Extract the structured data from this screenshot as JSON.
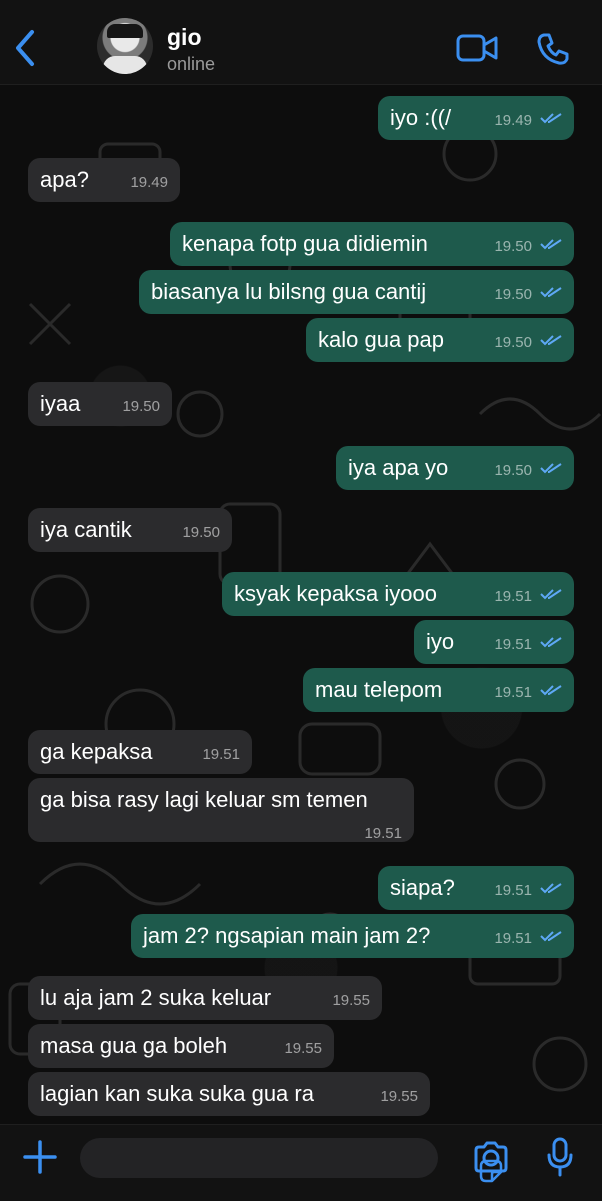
{
  "header": {
    "contact_name": "gio",
    "status": "online"
  },
  "messages": [
    {
      "dir": "out",
      "text": "iyo :((/",
      "time": "19.49",
      "read": true
    },
    {
      "dir": "in",
      "text": "apa?",
      "time": "19.49"
    },
    {
      "dir": "out",
      "text": "kenapa fotp gua didiemin",
      "time": "19.50",
      "read": true
    },
    {
      "dir": "out",
      "text": "biasanya lu bilsng gua cantij",
      "time": "19.50",
      "read": true
    },
    {
      "dir": "out",
      "text": "kalo gua pap",
      "time": "19.50",
      "read": true
    },
    {
      "dir": "in",
      "text": "iyaa",
      "time": "19.50"
    },
    {
      "dir": "out",
      "text": "iya apa yo",
      "time": "19.50",
      "read": true
    },
    {
      "dir": "in",
      "text": "iya cantik",
      "time": "19.50"
    },
    {
      "dir": "out",
      "text": "ksyak kepaksa iyooo",
      "time": "19.51",
      "read": true
    },
    {
      "dir": "out",
      "text": "iyo",
      "time": "19.51",
      "read": true
    },
    {
      "dir": "out",
      "text": "mau telepom",
      "time": "19.51",
      "read": true
    },
    {
      "dir": "in",
      "text": "ga kepaksa",
      "time": "19.51"
    },
    {
      "dir": "in",
      "text": "ga bisa rasy lagi keluar sm temen",
      "time": "19.51"
    },
    {
      "dir": "out",
      "text": "siapa?",
      "time": "19.51",
      "read": true
    },
    {
      "dir": "out",
      "text": "jam 2? ngsapian main jam 2?",
      "time": "19.51",
      "read": true
    },
    {
      "dir": "in",
      "text": "lu aja jam 2 suka keluar",
      "time": "19.55"
    },
    {
      "dir": "in",
      "text": "masa gua ga boleh",
      "time": "19.55"
    },
    {
      "dir": "in",
      "text": "lagian kan suka suka gua ra",
      "time": "19.55"
    }
  ],
  "colors": {
    "accent": "#3b8ff0",
    "outgoing_bubble": "#1e5a4c",
    "incoming_bubble": "#2b2b2d",
    "read_ticks": "#5ea8f5"
  },
  "icons": [
    "back-chevron-icon",
    "video-call-icon",
    "phone-icon",
    "plus-icon",
    "sticker-icon",
    "camera-icon",
    "mic-icon"
  ]
}
